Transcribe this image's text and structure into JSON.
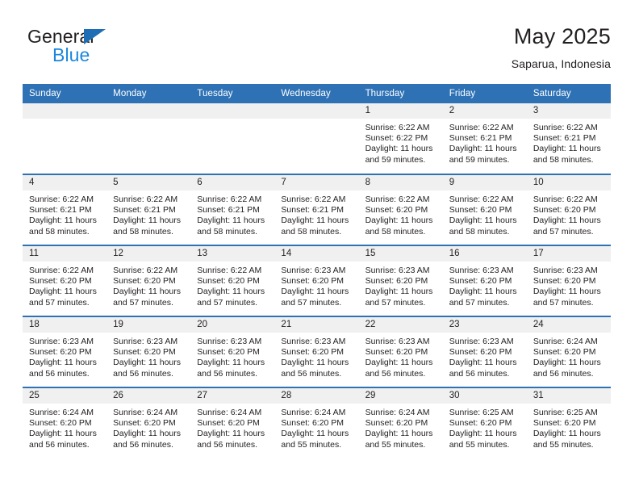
{
  "brand": {
    "word1": "General",
    "word2": "Blue",
    "triangle_color": "#1f6eb5",
    "blue_color": "#1b87dc"
  },
  "header": {
    "title": "May 2025",
    "location": "Saparua, Indonesia"
  },
  "theme": {
    "header_blue": "#2e72b5",
    "daynum_bg": "#f0f0f0",
    "text": "#231f20"
  },
  "weekday_headers": [
    "Sunday",
    "Monday",
    "Tuesday",
    "Wednesday",
    "Thursday",
    "Friday",
    "Saturday"
  ],
  "weeks": [
    [
      {
        "day": "",
        "sunrise": "",
        "sunset": "",
        "daylight1": "",
        "daylight2": ""
      },
      {
        "day": "",
        "sunrise": "",
        "sunset": "",
        "daylight1": "",
        "daylight2": ""
      },
      {
        "day": "",
        "sunrise": "",
        "sunset": "",
        "daylight1": "",
        "daylight2": ""
      },
      {
        "day": "",
        "sunrise": "",
        "sunset": "",
        "daylight1": "",
        "daylight2": ""
      },
      {
        "day": "1",
        "sunrise": "Sunrise: 6:22 AM",
        "sunset": "Sunset: 6:22 PM",
        "daylight1": "Daylight: 11 hours",
        "daylight2": "and 59 minutes."
      },
      {
        "day": "2",
        "sunrise": "Sunrise: 6:22 AM",
        "sunset": "Sunset: 6:21 PM",
        "daylight1": "Daylight: 11 hours",
        "daylight2": "and 59 minutes."
      },
      {
        "day": "3",
        "sunrise": "Sunrise: 6:22 AM",
        "sunset": "Sunset: 6:21 PM",
        "daylight1": "Daylight: 11 hours",
        "daylight2": "and 58 minutes."
      }
    ],
    [
      {
        "day": "4",
        "sunrise": "Sunrise: 6:22 AM",
        "sunset": "Sunset: 6:21 PM",
        "daylight1": "Daylight: 11 hours",
        "daylight2": "and 58 minutes."
      },
      {
        "day": "5",
        "sunrise": "Sunrise: 6:22 AM",
        "sunset": "Sunset: 6:21 PM",
        "daylight1": "Daylight: 11 hours",
        "daylight2": "and 58 minutes."
      },
      {
        "day": "6",
        "sunrise": "Sunrise: 6:22 AM",
        "sunset": "Sunset: 6:21 PM",
        "daylight1": "Daylight: 11 hours",
        "daylight2": "and 58 minutes."
      },
      {
        "day": "7",
        "sunrise": "Sunrise: 6:22 AM",
        "sunset": "Sunset: 6:21 PM",
        "daylight1": "Daylight: 11 hours",
        "daylight2": "and 58 minutes."
      },
      {
        "day": "8",
        "sunrise": "Sunrise: 6:22 AM",
        "sunset": "Sunset: 6:20 PM",
        "daylight1": "Daylight: 11 hours",
        "daylight2": "and 58 minutes."
      },
      {
        "day": "9",
        "sunrise": "Sunrise: 6:22 AM",
        "sunset": "Sunset: 6:20 PM",
        "daylight1": "Daylight: 11 hours",
        "daylight2": "and 58 minutes."
      },
      {
        "day": "10",
        "sunrise": "Sunrise: 6:22 AM",
        "sunset": "Sunset: 6:20 PM",
        "daylight1": "Daylight: 11 hours",
        "daylight2": "and 57 minutes."
      }
    ],
    [
      {
        "day": "11",
        "sunrise": "Sunrise: 6:22 AM",
        "sunset": "Sunset: 6:20 PM",
        "daylight1": "Daylight: 11 hours",
        "daylight2": "and 57 minutes."
      },
      {
        "day": "12",
        "sunrise": "Sunrise: 6:22 AM",
        "sunset": "Sunset: 6:20 PM",
        "daylight1": "Daylight: 11 hours",
        "daylight2": "and 57 minutes."
      },
      {
        "day": "13",
        "sunrise": "Sunrise: 6:22 AM",
        "sunset": "Sunset: 6:20 PM",
        "daylight1": "Daylight: 11 hours",
        "daylight2": "and 57 minutes."
      },
      {
        "day": "14",
        "sunrise": "Sunrise: 6:23 AM",
        "sunset": "Sunset: 6:20 PM",
        "daylight1": "Daylight: 11 hours",
        "daylight2": "and 57 minutes."
      },
      {
        "day": "15",
        "sunrise": "Sunrise: 6:23 AM",
        "sunset": "Sunset: 6:20 PM",
        "daylight1": "Daylight: 11 hours",
        "daylight2": "and 57 minutes."
      },
      {
        "day": "16",
        "sunrise": "Sunrise: 6:23 AM",
        "sunset": "Sunset: 6:20 PM",
        "daylight1": "Daylight: 11 hours",
        "daylight2": "and 57 minutes."
      },
      {
        "day": "17",
        "sunrise": "Sunrise: 6:23 AM",
        "sunset": "Sunset: 6:20 PM",
        "daylight1": "Daylight: 11 hours",
        "daylight2": "and 57 minutes."
      }
    ],
    [
      {
        "day": "18",
        "sunrise": "Sunrise: 6:23 AM",
        "sunset": "Sunset: 6:20 PM",
        "daylight1": "Daylight: 11 hours",
        "daylight2": "and 56 minutes."
      },
      {
        "day": "19",
        "sunrise": "Sunrise: 6:23 AM",
        "sunset": "Sunset: 6:20 PM",
        "daylight1": "Daylight: 11 hours",
        "daylight2": "and 56 minutes."
      },
      {
        "day": "20",
        "sunrise": "Sunrise: 6:23 AM",
        "sunset": "Sunset: 6:20 PM",
        "daylight1": "Daylight: 11 hours",
        "daylight2": "and 56 minutes."
      },
      {
        "day": "21",
        "sunrise": "Sunrise: 6:23 AM",
        "sunset": "Sunset: 6:20 PM",
        "daylight1": "Daylight: 11 hours",
        "daylight2": "and 56 minutes."
      },
      {
        "day": "22",
        "sunrise": "Sunrise: 6:23 AM",
        "sunset": "Sunset: 6:20 PM",
        "daylight1": "Daylight: 11 hours",
        "daylight2": "and 56 minutes."
      },
      {
        "day": "23",
        "sunrise": "Sunrise: 6:23 AM",
        "sunset": "Sunset: 6:20 PM",
        "daylight1": "Daylight: 11 hours",
        "daylight2": "and 56 minutes."
      },
      {
        "day": "24",
        "sunrise": "Sunrise: 6:24 AM",
        "sunset": "Sunset: 6:20 PM",
        "daylight1": "Daylight: 11 hours",
        "daylight2": "and 56 minutes."
      }
    ],
    [
      {
        "day": "25",
        "sunrise": "Sunrise: 6:24 AM",
        "sunset": "Sunset: 6:20 PM",
        "daylight1": "Daylight: 11 hours",
        "daylight2": "and 56 minutes."
      },
      {
        "day": "26",
        "sunrise": "Sunrise: 6:24 AM",
        "sunset": "Sunset: 6:20 PM",
        "daylight1": "Daylight: 11 hours",
        "daylight2": "and 56 minutes."
      },
      {
        "day": "27",
        "sunrise": "Sunrise: 6:24 AM",
        "sunset": "Sunset: 6:20 PM",
        "daylight1": "Daylight: 11 hours",
        "daylight2": "and 56 minutes."
      },
      {
        "day": "28",
        "sunrise": "Sunrise: 6:24 AM",
        "sunset": "Sunset: 6:20 PM",
        "daylight1": "Daylight: 11 hours",
        "daylight2": "and 55 minutes."
      },
      {
        "day": "29",
        "sunrise": "Sunrise: 6:24 AM",
        "sunset": "Sunset: 6:20 PM",
        "daylight1": "Daylight: 11 hours",
        "daylight2": "and 55 minutes."
      },
      {
        "day": "30",
        "sunrise": "Sunrise: 6:25 AM",
        "sunset": "Sunset: 6:20 PM",
        "daylight1": "Daylight: 11 hours",
        "daylight2": "and 55 minutes."
      },
      {
        "day": "31",
        "sunrise": "Sunrise: 6:25 AM",
        "sunset": "Sunset: 6:20 PM",
        "daylight1": "Daylight: 11 hours",
        "daylight2": "and 55 minutes."
      }
    ]
  ]
}
